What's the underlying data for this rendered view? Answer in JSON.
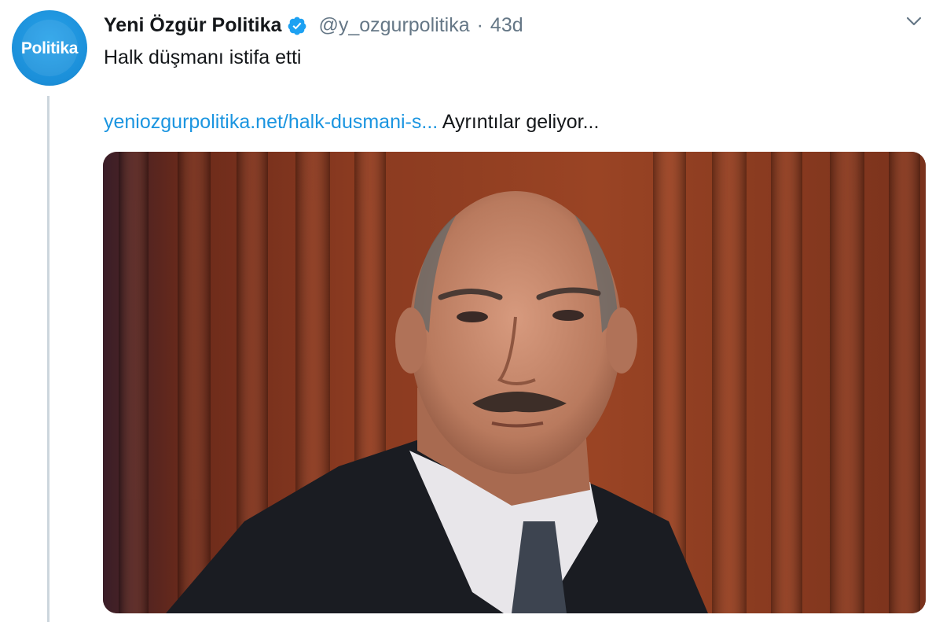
{
  "tweet": {
    "author": {
      "display_name": "Yeni Özgür Politika",
      "handle": "@y_ozgurpolitika",
      "verified": true,
      "avatar_text": "Politika"
    },
    "separator": "·",
    "timestamp": "43d",
    "text": "Halk düşmanı istifa etti",
    "link_text": "yeniozgurpolitika.net/halk-dusmani-s...",
    "link_trailing_text": "Ayrıntılar geliyor...",
    "media_icon": "photo"
  },
  "colors": {
    "accent": "#1b95e0",
    "avatar_bg": "#1b8fd9",
    "text_primary": "#14171a",
    "text_secondary": "#657786",
    "thread_line": "#ccd6dd"
  }
}
